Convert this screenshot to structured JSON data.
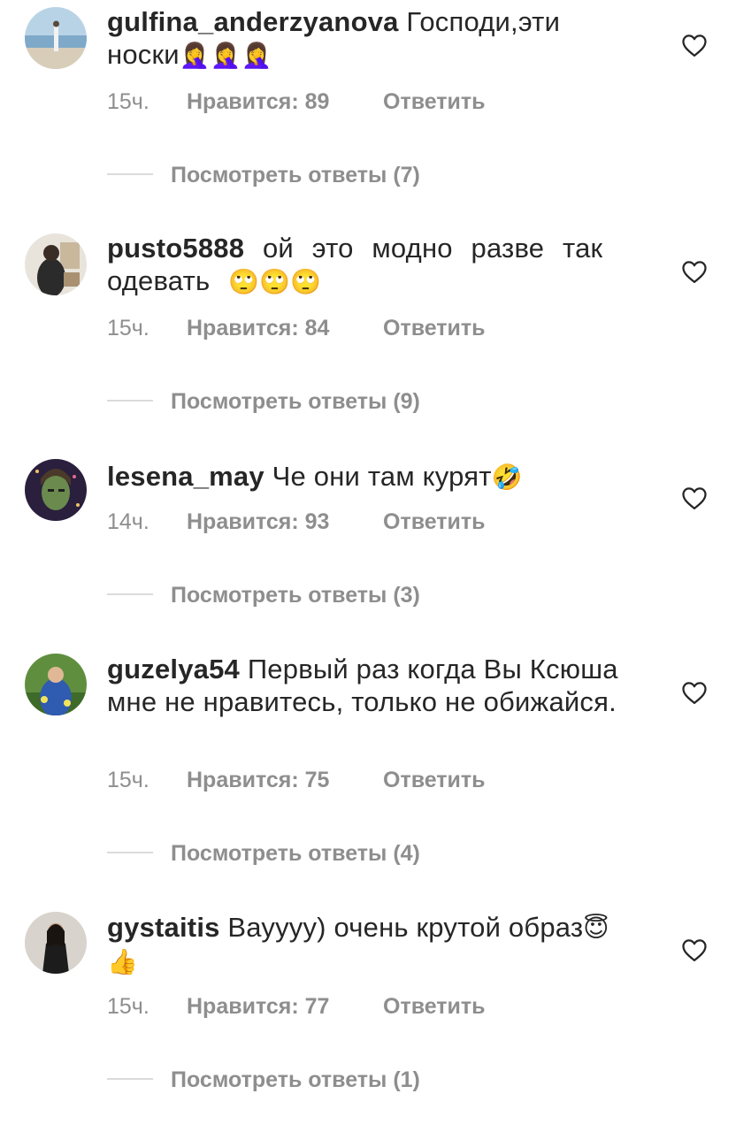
{
  "comments": [
    {
      "username": "gulfina_anderzyanova",
      "text": "Господи,эти носки",
      "emoji": "🤦‍♀️🤦‍♀️🤦‍♀️",
      "time": "15ч.",
      "likes": "Нравится: 89",
      "reply": "Ответить",
      "view_replies": "Посмотреть ответы (7)"
    },
    {
      "username": "pusto5888",
      "text": "ой это модно разве так одевать",
      "emoji": "🙄🙄🙄",
      "time": "15ч.",
      "likes": "Нравится: 84",
      "reply": "Ответить",
      "view_replies": "Посмотреть ответы (9)"
    },
    {
      "username": "lesena_may",
      "text": "Че они там курят",
      "emoji": "🤣",
      "time": "14ч.",
      "likes": "Нравится: 93",
      "reply": "Ответить",
      "view_replies": "Посмотреть ответы (3)"
    },
    {
      "username": "guzelya54",
      "text": "Первый раз когда Вы Ксюша мне не нравитесь, только не обижайся.",
      "emoji": "",
      "time": "15ч.",
      "likes": "Нравится: 75",
      "reply": "Ответить",
      "view_replies": "Посмотреть ответы (4)"
    },
    {
      "username": "gystaitis",
      "text": "Вауууу) очень крутой образ",
      "emoji": "😇👍",
      "time": "15ч.",
      "likes": "Нравится: 77",
      "reply": "Ответить",
      "view_replies": "Посмотреть ответы (1)"
    }
  ],
  "icons": {
    "like": "heart-outline-icon"
  },
  "colors": {
    "text": "#262626",
    "secondary": "#8e8e8e",
    "divider": "#dbdbdb"
  }
}
